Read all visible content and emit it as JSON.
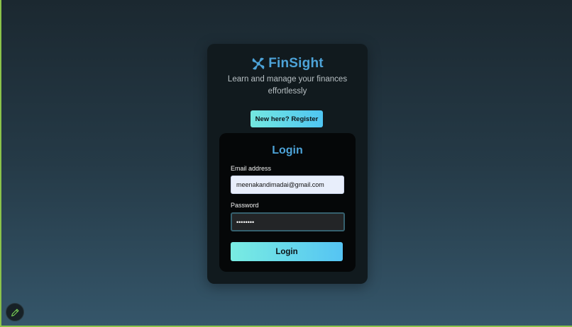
{
  "brand": {
    "name": "FinSight",
    "icon": "pinwheel-logo-icon",
    "color": "#4da3d8"
  },
  "tagline": "Learn and manage your finances effortlessly",
  "register_button": {
    "label": "New here? Register"
  },
  "login_form": {
    "title": "Login",
    "email": {
      "label": "Email address",
      "value": "meenakandimadai@gmail.com"
    },
    "password": {
      "label": "Password",
      "value": "••••••••"
    },
    "submit_label": "Login"
  },
  "edit_button": {
    "icon": "pencil-icon"
  },
  "colors": {
    "accent": "#4da3d8",
    "button_gradient_start": "#74e8e0",
    "button_gradient_end": "#4fc5f2",
    "frame": "#8bc34a"
  }
}
